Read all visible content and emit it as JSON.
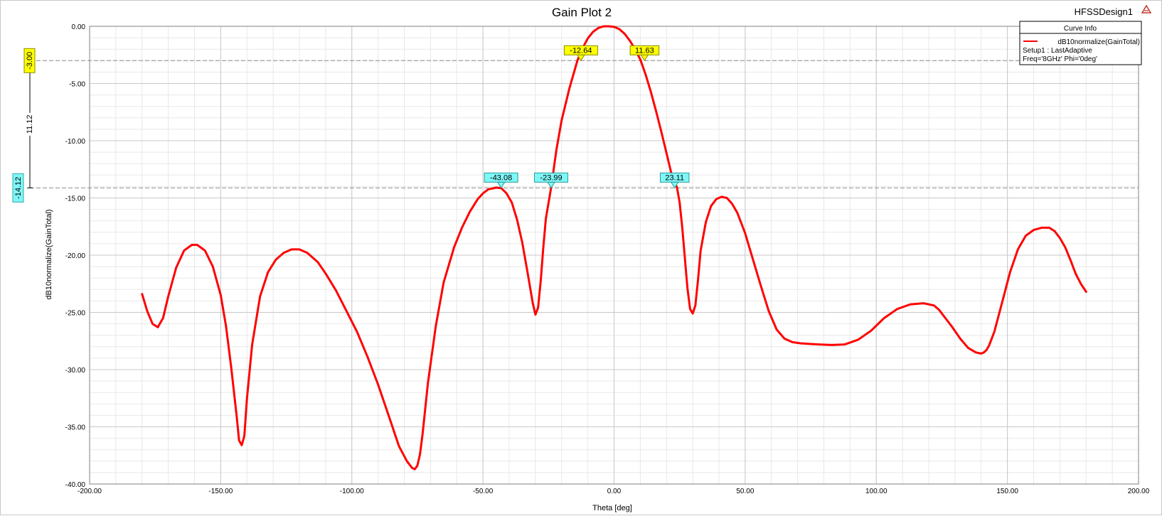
{
  "window": {
    "title": "Gain Plot 2",
    "design_name": "HFSSDesign1"
  },
  "colors": {
    "curve": "#ff0000",
    "grid_major": "#c8c8c8",
    "grid_minor": "#e8e8e8",
    "marker_yellow": "#ffff00",
    "marker_cyan": "#7ff7f7",
    "background": "#ffffff"
  },
  "legend": {
    "header": "Curve Info",
    "entry": "dB10normalize(GainTotal)",
    "setup": "Setup1 : LastAdaptive",
    "freq": "Freq='8GHz' Phi='0deg'"
  },
  "delta_markers": {
    "upper_level": "-3.00",
    "lower_level": "-14.12",
    "delta": "11.12"
  },
  "chart_data": {
    "type": "line",
    "title": "Gain Plot 2",
    "xlabel": "Theta [deg]",
    "ylabel": "dB10normalize(GainTotal)",
    "xlim": [
      -200,
      200
    ],
    "ylim": [
      -40,
      0
    ],
    "x_ticks": [
      "-200.00",
      "-150.00",
      "-100.00",
      "-50.00",
      "0.00",
      "50.00",
      "100.00",
      "150.00",
      "200.00"
    ],
    "y_ticks": [
      "0.00",
      "-5.00",
      "-10.00",
      "-15.00",
      "-20.00",
      "-25.00",
      "-30.00",
      "-35.00",
      "-40.00"
    ],
    "grid": true,
    "legend_position": "top-right",
    "series": [
      {
        "name": "dB10normalize(GainTotal)",
        "x": [
          -180,
          -178,
          -176,
          -174,
          -172,
          -170,
          -167,
          -164,
          -161,
          -159,
          -156,
          -153,
          -150,
          -148,
          -146,
          -144,
          -143,
          -142,
          -141,
          -140,
          -138,
          -135,
          -132,
          -129,
          -126,
          -123,
          -120,
          -117,
          -113,
          -110,
          -106,
          -102,
          -98,
          -94,
          -90,
          -86,
          -82,
          -79,
          -77,
          -76,
          -75,
          -74,
          -73,
          -71,
          -68,
          -65,
          -61,
          -58,
          -55,
          -52,
          -50,
          -48,
          -45,
          -43,
          -41,
          -39,
          -37,
          -35,
          -33,
          -31,
          -30,
          -29,
          -28,
          -27,
          -26,
          -24,
          -22,
          -20,
          -17,
          -14,
          -12,
          -10,
          -8,
          -6,
          -4,
          -2,
          0,
          2,
          4,
          6,
          8,
          10,
          12,
          14,
          16,
          18,
          20,
          22,
          24,
          25,
          26,
          27,
          28,
          29,
          30,
          31,
          32,
          33,
          35,
          37,
          39,
          41,
          43,
          45,
          47,
          50,
          53,
          56,
          59,
          62,
          65,
          68,
          71,
          74,
          78,
          83,
          88,
          93,
          98,
          103,
          108,
          113,
          118,
          122,
          124,
          126,
          129,
          132,
          135,
          138,
          140,
          141,
          142,
          143,
          145,
          148,
          151,
          154,
          157,
          160,
          163,
          166,
          168,
          170,
          172,
          174,
          176,
          178,
          180
        ],
        "y": [
          -23.4,
          -24.9,
          -26.0,
          -26.3,
          -25.5,
          -23.6,
          -21.1,
          -19.6,
          -19.1,
          -19.1,
          -19.6,
          -21.0,
          -23.5,
          -26.2,
          -29.8,
          -33.9,
          -36.2,
          -36.6,
          -35.8,
          -32.5,
          -27.8,
          -23.6,
          -21.5,
          -20.4,
          -19.8,
          -19.5,
          -19.5,
          -19.8,
          -20.6,
          -21.6,
          -23.1,
          -24.9,
          -26.7,
          -28.9,
          -31.3,
          -34.0,
          -36.7,
          -38.0,
          -38.6,
          -38.7,
          -38.4,
          -37.4,
          -35.6,
          -31.2,
          -26.2,
          -22.4,
          -19.3,
          -17.6,
          -16.2,
          -15.1,
          -14.6,
          -14.25,
          -14.1,
          -14.15,
          -14.6,
          -15.4,
          -16.9,
          -18.9,
          -21.5,
          -24.2,
          -25.2,
          -24.6,
          -22.3,
          -19.4,
          -16.8,
          -14.1,
          -10.8,
          -8.2,
          -5.4,
          -3.0,
          -1.9,
          -1.05,
          -0.48,
          -0.15,
          0.0,
          0.0,
          -0.05,
          -0.25,
          -0.65,
          -1.25,
          -2.0,
          -2.9,
          -4.2,
          -5.7,
          -7.4,
          -9.2,
          -11.1,
          -13.0,
          -14.1,
          -15.4,
          -17.6,
          -20.3,
          -22.9,
          -24.7,
          -25.1,
          -24.4,
          -22.2,
          -19.6,
          -17.1,
          -15.7,
          -15.1,
          -14.9,
          -15.0,
          -15.5,
          -16.3,
          -18.1,
          -20.4,
          -22.7,
          -24.9,
          -26.5,
          -27.3,
          -27.6,
          -27.7,
          -27.75,
          -27.8,
          -27.85,
          -27.8,
          -27.4,
          -26.6,
          -25.5,
          -24.7,
          -24.3,
          -24.2,
          -24.4,
          -24.8,
          -25.4,
          -26.3,
          -27.3,
          -28.1,
          -28.5,
          -28.6,
          -28.5,
          -28.3,
          -27.9,
          -26.7,
          -24.1,
          -21.5,
          -19.5,
          -18.3,
          -17.8,
          -17.6,
          -17.6,
          -17.9,
          -18.5,
          -19.3,
          -20.4,
          -21.6,
          -22.5,
          -23.2
        ]
      }
    ],
    "markers": [
      {
        "label": "-12.64",
        "x": -12.64,
        "y": -3.0,
        "color": "yellow"
      },
      {
        "label": "11.63",
        "x": 11.63,
        "y": -3.0,
        "color": "yellow"
      },
      {
        "label": "-43.08",
        "x": -43.08,
        "y": -14.12,
        "color": "cyan"
      },
      {
        "label": "-23.99",
        "x": -23.99,
        "y": -14.12,
        "color": "cyan"
      },
      {
        "label": "23.11",
        "x": 23.11,
        "y": -14.12,
        "color": "cyan"
      }
    ],
    "reference_lines": [
      -3.0,
      -14.12
    ]
  }
}
